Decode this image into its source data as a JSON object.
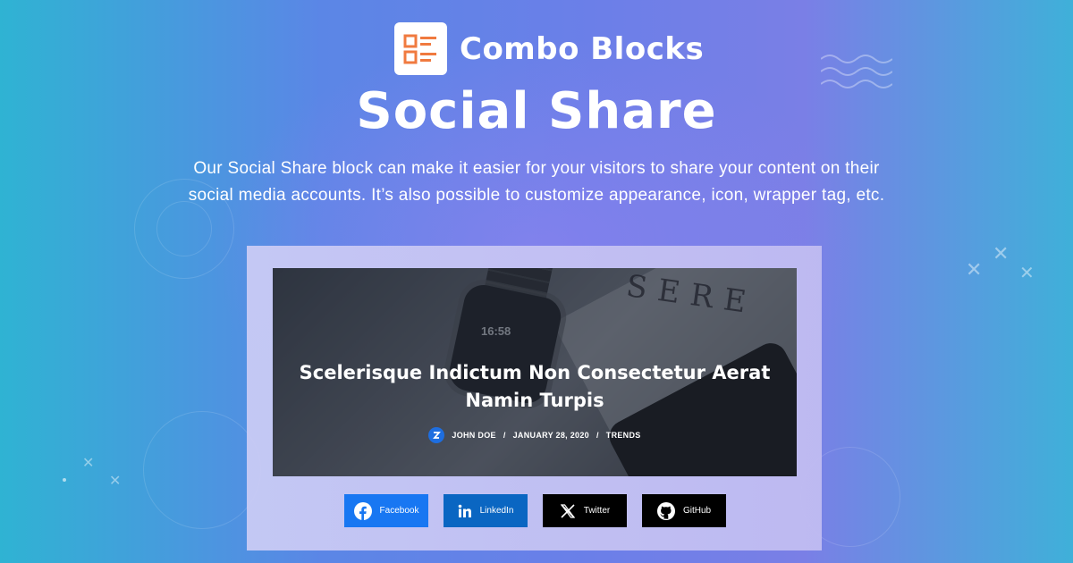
{
  "brand": {
    "name": "Combo Blocks",
    "logo_icon": "list-layout-icon",
    "logo_color": "#f07a3f"
  },
  "heading": {
    "title": "Social Share"
  },
  "description": "Our Social Share block can make it easier for your visitors to share your content on their social media accounts. It’s also possible to customize appearance, icon, wrapper tag, etc.",
  "preview": {
    "post_title": "Scelerisque Indictum Non Consectetur Aerat Namin Turpis",
    "author": "JOHN DOE",
    "date": "JANUARY 28, 2020",
    "category": "TRENDS",
    "watch_time": "16:58",
    "sign_letters": "SERE"
  },
  "share_buttons": [
    {
      "label": "Facebook",
      "icon": "facebook-icon",
      "color": "#1877f2"
    },
    {
      "label": "LinkedIn",
      "icon": "linkedin-icon",
      "color": "#0a66c2"
    },
    {
      "label": "Twitter",
      "icon": "x-twitter-icon",
      "color": "#000000"
    },
    {
      "label": "GitHub",
      "icon": "github-icon",
      "color": "#000000"
    }
  ]
}
